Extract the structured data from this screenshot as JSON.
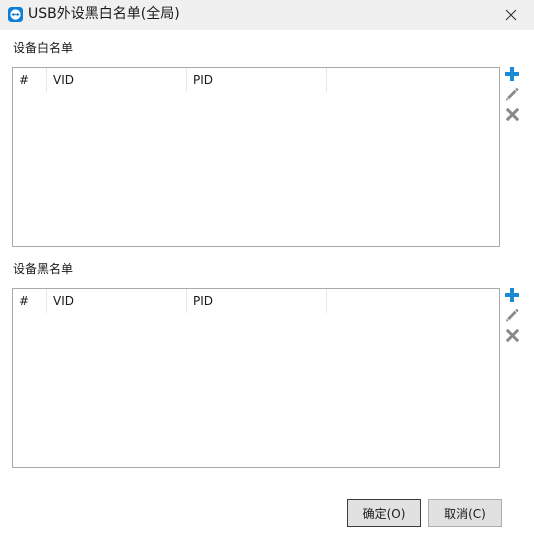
{
  "window": {
    "title": "USB外设黑白名单(全局)"
  },
  "whitelist": {
    "label": "设备白名单",
    "columns": [
      "#",
      "VID",
      "PID",
      ""
    ]
  },
  "blacklist": {
    "label": "设备黑名单",
    "columns": [
      "#",
      "VID",
      "PID",
      ""
    ]
  },
  "buttons": {
    "ok": "确定(O)",
    "cancel": "取消(C)"
  },
  "icons": {
    "app": "teamviewer-logo-icon",
    "close": "close-icon",
    "add": "plus-icon",
    "edit": "pencil-icon",
    "delete": "x-icon"
  },
  "colors": {
    "accent": "#1a8ad4",
    "tool_gray": "#8a8a8a",
    "titlebar": "#f0f0f0"
  }
}
